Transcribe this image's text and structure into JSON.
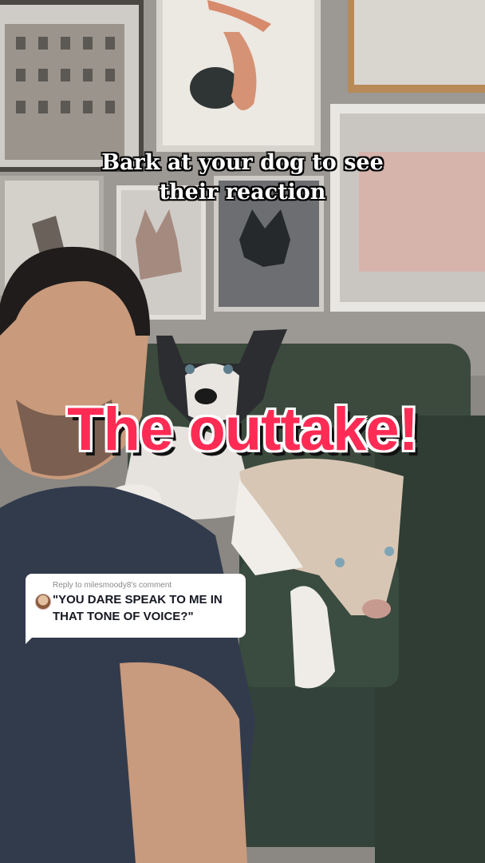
{
  "caption": {
    "line1": "Bark at your dog to see",
    "line2": "their reaction"
  },
  "overlay_title": "The outtake!",
  "reply": {
    "label": "Reply to milesmoody8's comment",
    "comment": "\"YOU DARE SPEAK TO ME IN THAT TONE OF VOICE?\"",
    "avatar_icon": "user-avatar-icon"
  },
  "colors": {
    "accent": "#fe2c55",
    "wall": "#8e8a86",
    "couch": "#3a4a3c",
    "shirt": "#323b4c"
  }
}
